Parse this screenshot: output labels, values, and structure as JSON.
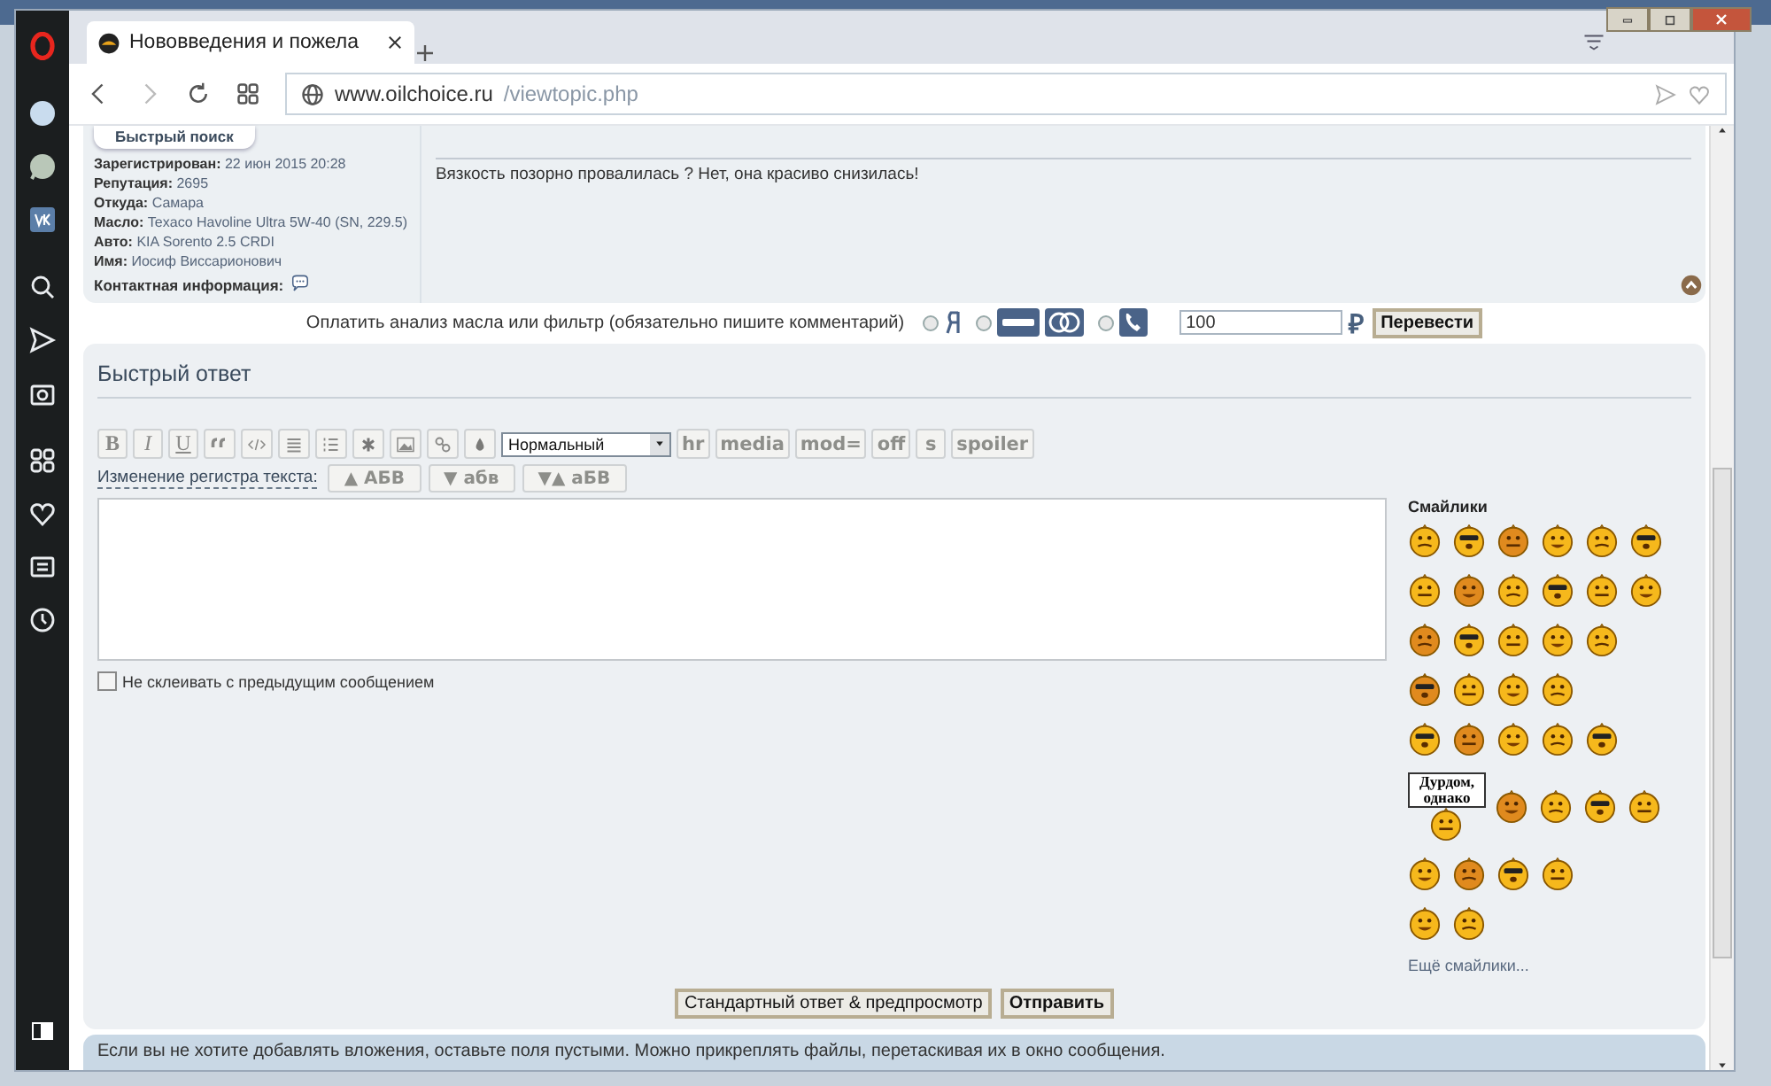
{
  "browser": {
    "tabs": [
      {
        "title": "Нововведения и пожела",
        "selected": true
      }
    ],
    "url_domain": "www.oilchoice.ru",
    "url_path": "/viewtopic.php"
  },
  "profile": {
    "quick_search": "Быстрый поиск",
    "fields": [
      {
        "label": "Зарегистрирован:",
        "value": "22 июн 2015 20:28"
      },
      {
        "label": "Репутация:",
        "value": "2695"
      },
      {
        "label": "Откуда:",
        "value": "Самара"
      },
      {
        "label": "Масло:",
        "value": "Texaco Havoline Ultra 5W-40 (SN, 229.5)"
      },
      {
        "label": "Авто:",
        "value": "KIA Sorento 2.5 CRDI"
      },
      {
        "label": "Имя:",
        "value": "Иосиф Виссарионович"
      }
    ],
    "contact_label": "Контактная информация:"
  },
  "post": {
    "signature": "Вязкость позорно провалилась ? Нет, она красиво снизилась!"
  },
  "payment": {
    "label": "Оплатить анализ масла или фильтр (обязательно пишите комментарий)",
    "options": [
      {
        "kind": "yandex",
        "selected": false
      },
      {
        "kind": "cards",
        "selected": false
      },
      {
        "kind": "phone",
        "selected": false
      }
    ],
    "amount": "100",
    "currency": "₽",
    "button": "Перевести"
  },
  "quick_reply": {
    "title": "Быстрый ответ",
    "format_buttons": [
      {
        "kind": "bold",
        "label": "B"
      },
      {
        "kind": "italic",
        "label": "I"
      },
      {
        "kind": "underline",
        "label": "U"
      }
    ],
    "size_select": "Нормальный",
    "tag_buttons": [
      "hr",
      "media",
      "mod=",
      "off",
      "s",
      "spoiler"
    ],
    "case_label": "Изменение регистра текста:",
    "case_buttons": [
      "▲ АБВ",
      "▼ абв",
      "▼▲ аБВ"
    ],
    "no_merge": {
      "label": "Не склеивать с предыдущим сообщением",
      "checked": false
    },
    "smileys_title": "Смайлики",
    "sign_text": "Дурдом, однако",
    "more_smileys": "Ещё смайлики...",
    "buttons": [
      {
        "kind": "secondary",
        "label": "Стандартный ответ & предпросмотр"
      },
      {
        "kind": "primary",
        "label": "Отправить"
      }
    ]
  },
  "attachments_note": "Если вы не хотите добавлять вложения, оставьте поля пустыми. Можно прикреплять файлы, перетаскивая их в окно сообщения."
}
